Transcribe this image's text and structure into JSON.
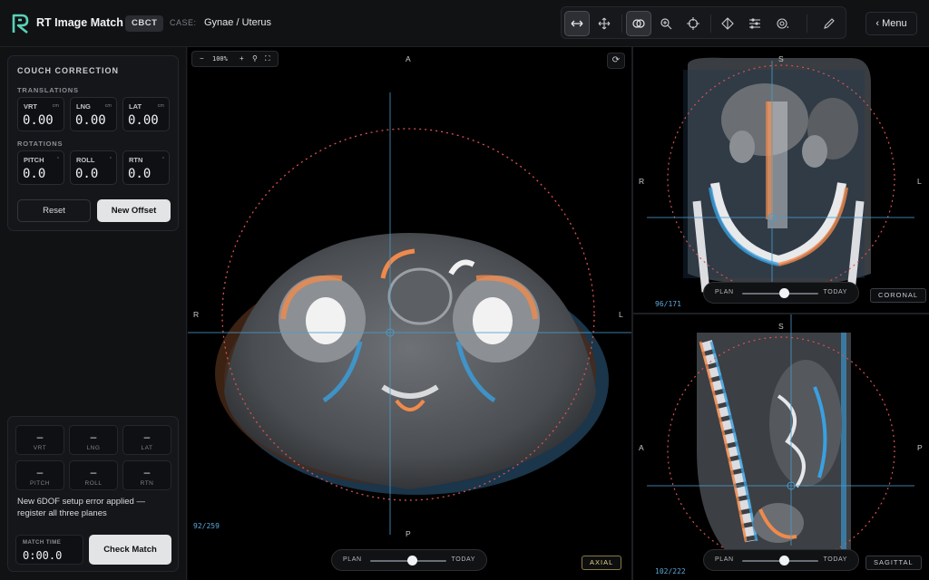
{
  "header": {
    "app_title": "RT Image Match",
    "modality": "CBCT",
    "case_label": "CASE:",
    "case_value": "Gynae / Uterus",
    "menu_label": "‹ Menu",
    "tools": [
      "swap-arrows-icon",
      "move-icon",
      "overlay-icon",
      "zoom-icon",
      "crosshair-icon",
      "diamond-icon",
      "sliders-icon",
      "contour-icon",
      "pen-icon"
    ]
  },
  "couch": {
    "title": "COUCH CORRECTION",
    "translations_label": "TRANSLATIONS",
    "rotations_label": "ROTATIONS",
    "translations": [
      {
        "label": "VRT",
        "unit": "cm",
        "value": "0.00"
      },
      {
        "label": "LNG",
        "unit": "cm",
        "value": "0.00"
      },
      {
        "label": "LAT",
        "unit": "cm",
        "value": "0.00"
      }
    ],
    "rotations": [
      {
        "label": "PITCH",
        "unit": "°",
        "value": "0.0"
      },
      {
        "label": "ROLL",
        "unit": "°",
        "value": "0.0"
      },
      {
        "label": "RTN",
        "unit": "°",
        "value": "0.0"
      }
    ],
    "reset_label": "Reset",
    "offset_label": "New Offset"
  },
  "setup_error": {
    "cells": [
      {
        "value": "–",
        "label": "VRT"
      },
      {
        "value": "–",
        "label": "LNG"
      },
      {
        "value": "–",
        "label": "LAT"
      },
      {
        "value": "–",
        "label": "PITCH"
      },
      {
        "value": "–",
        "label": "ROLL"
      },
      {
        "value": "–",
        "label": "RTN"
      }
    ],
    "message": "New 6DOF setup error applied — register all three planes",
    "match_time_label": "MATCH TIME",
    "match_time_value": "0:00.0",
    "check_label": "Check Match"
  },
  "axial": {
    "zoom_minus": "−",
    "zoom_value": "100%",
    "zoom_plus": "+",
    "top": "A",
    "bottom": "P",
    "left": "R",
    "right": "L",
    "slice": "92/259",
    "label": "AXIAL",
    "slider_left": "PLAN",
    "slider_right": "TODAY",
    "blend": 0.55
  },
  "coronal": {
    "top": "S",
    "left": "R",
    "right": "L",
    "slice": "96/171",
    "label": "CORONAL",
    "slider_left": "PLAN",
    "slider_right": "TODAY",
    "blend": 0.55
  },
  "sagittal": {
    "top": "S",
    "left": "A",
    "right": "P",
    "slice": "102/222",
    "label": "SAGITTAL",
    "slider_left": "PLAN",
    "slider_right": "TODAY",
    "blend": 0.55
  },
  "colors": {
    "plan_overlay": "#f08a4b",
    "today_overlay": "#3aa0e0",
    "crosshair": "#4a9ccc",
    "roi_circle": "#d9534f"
  }
}
